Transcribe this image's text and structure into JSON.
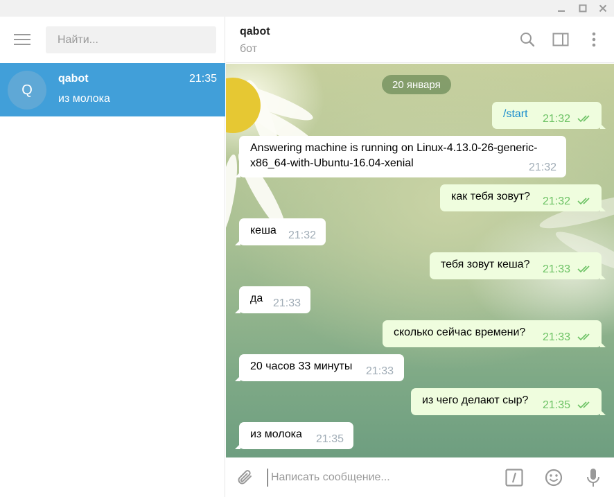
{
  "window": {
    "controls": [
      "minimize-icon",
      "maximize-icon",
      "close-icon"
    ]
  },
  "sidebar": {
    "search_placeholder": "Найти...",
    "chats": [
      {
        "avatar_letter": "Q",
        "name": "qabot",
        "time": "21:35",
        "preview": "из молока",
        "active": true
      }
    ]
  },
  "header": {
    "title": "qabot",
    "subtitle": "бот",
    "icons": [
      "search-icon",
      "sidebar-toggle-icon",
      "more-vertical-icon"
    ]
  },
  "chat": {
    "date_label": "20 января",
    "messages": [
      {
        "direction": "out",
        "text": "/start",
        "time": "21:32",
        "read": true
      },
      {
        "direction": "in",
        "text_lines": [
          "Answering machine is running on Linux-4.13.0-26-generic-",
          "x86_64-with-Ubuntu-16.04-xenial"
        ],
        "time": "21:32"
      },
      {
        "direction": "out",
        "text": "как тебя зовут?",
        "time": "21:32",
        "read": true
      },
      {
        "direction": "in",
        "text": "кеша",
        "time": "21:32"
      },
      {
        "direction": "out",
        "text": "тебя зовут кеша?",
        "time": "21:33",
        "read": true
      },
      {
        "direction": "in",
        "text": "да",
        "time": "21:33"
      },
      {
        "direction": "out",
        "text": "сколько сейчас времени?",
        "time": "21:33",
        "read": true
      },
      {
        "direction": "in",
        "text": "20 часов 33 минуты",
        "time": "21:33"
      },
      {
        "direction": "out",
        "text": "из чего делают сыр?",
        "time": "21:35",
        "read": true
      },
      {
        "direction": "in",
        "text": "из молока",
        "time": "21:35"
      }
    ]
  },
  "composer": {
    "placeholder": "Написать сообщение...",
    "icons": [
      "attach-icon",
      "bot-command-icon",
      "emoji-icon",
      "microphone-icon"
    ]
  },
  "colors": {
    "accent": "#419fd9",
    "outgoing_bubble": "#effdde",
    "read_ticks": "#6cc264"
  }
}
